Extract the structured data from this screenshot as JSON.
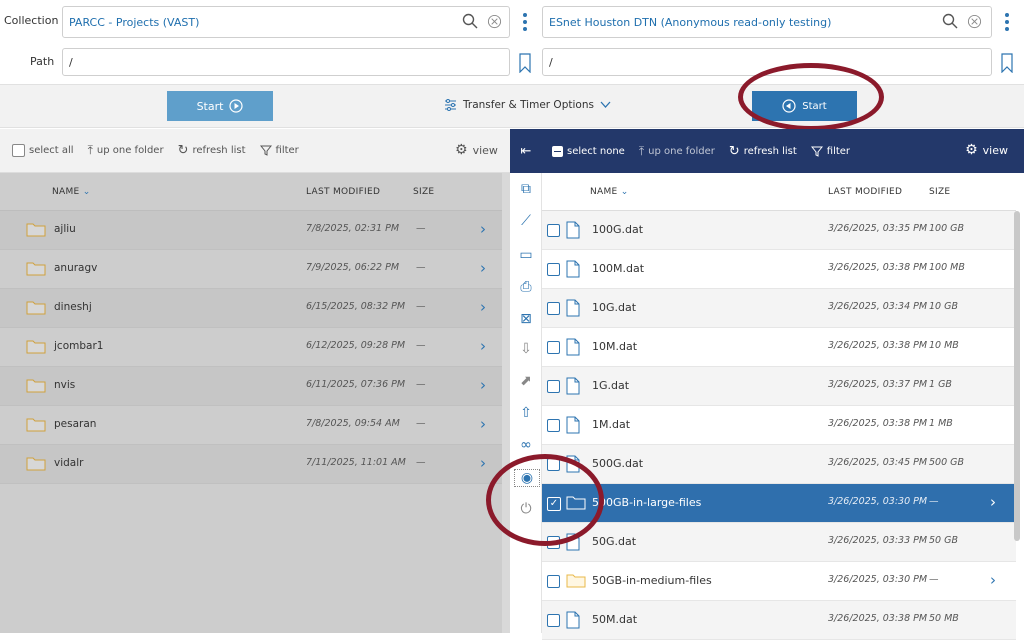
{
  "collection": {
    "label": "Collection",
    "left_value": "PARCC - Projects (VAST)",
    "right_value": "ESnet Houston DTN (Anonymous read-only testing)"
  },
  "path": {
    "label": "Path",
    "left_value": "/",
    "right_value": "/"
  },
  "toolbar": {
    "start_label": "Start",
    "options_label": "Transfer & Timer Options",
    "start_right_label": "Start"
  },
  "left_actions": {
    "select_all": "select all",
    "up_one_folder": "up one folder",
    "refresh_list": "refresh list",
    "filter": "filter",
    "view": "view"
  },
  "right_actions": {
    "select_none": "select none",
    "up_one_folder": "up one folder",
    "refresh_list": "refresh list",
    "filter": "filter",
    "view": "view"
  },
  "columns": {
    "name": "NAME",
    "last_modified": "LAST MODIFIED",
    "size": "SIZE"
  },
  "left_rows": [
    {
      "name": "ajliu",
      "date": "7/8/2025, 02:31 PM",
      "size": "—"
    },
    {
      "name": "anuragv",
      "date": "7/9/2025, 06:22 PM",
      "size": "—"
    },
    {
      "name": "dineshj",
      "date": "6/15/2025, 08:32 PM",
      "size": "—"
    },
    {
      "name": "jcombar1",
      "date": "6/12/2025, 09:28 PM",
      "size": "—"
    },
    {
      "name": "nvis",
      "date": "6/11/2025, 07:36 PM",
      "size": "—"
    },
    {
      "name": "pesaran",
      "date": "7/8/2025, 09:54 AM",
      "size": "—"
    },
    {
      "name": "vidalr",
      "date": "7/11/2025, 11:01 AM",
      "size": "—"
    }
  ],
  "right_rows": [
    {
      "name": "100G.dat",
      "date": "3/26/2025, 03:35 PM",
      "size": "100 GB",
      "type": "file"
    },
    {
      "name": "100M.dat",
      "date": "3/26/2025, 03:38 PM",
      "size": "100 MB",
      "type": "file"
    },
    {
      "name": "10G.dat",
      "date": "3/26/2025, 03:34 PM",
      "size": "10 GB",
      "type": "file"
    },
    {
      "name": "10M.dat",
      "date": "3/26/2025, 03:38 PM",
      "size": "10 MB",
      "type": "file"
    },
    {
      "name": "1G.dat",
      "date": "3/26/2025, 03:37 PM",
      "size": "1 GB",
      "type": "file"
    },
    {
      "name": "1M.dat",
      "date": "3/26/2025, 03:38 PM",
      "size": "1 MB",
      "type": "file"
    },
    {
      "name": "500G.dat",
      "date": "3/26/2025, 03:45 PM",
      "size": "500 GB",
      "type": "file"
    },
    {
      "name": "500GB-in-large-files",
      "date": "3/26/2025, 03:30 PM",
      "size": "—",
      "type": "folder",
      "selected": true
    },
    {
      "name": "50G.dat",
      "date": "3/26/2025, 03:33 PM",
      "size": "50 GB",
      "type": "file"
    },
    {
      "name": "50GB-in-medium-files",
      "date": "3/26/2025, 03:30 PM",
      "size": "—",
      "type": "folder"
    },
    {
      "name": "50M.dat",
      "date": "3/26/2025, 03:38 PM",
      "size": "50 MB",
      "type": "file"
    }
  ],
  "colors": {
    "accent": "#2d74b0",
    "dark_bar": "#23386a",
    "annotation": "#8b1a2b",
    "folder": "#e8b84a"
  }
}
